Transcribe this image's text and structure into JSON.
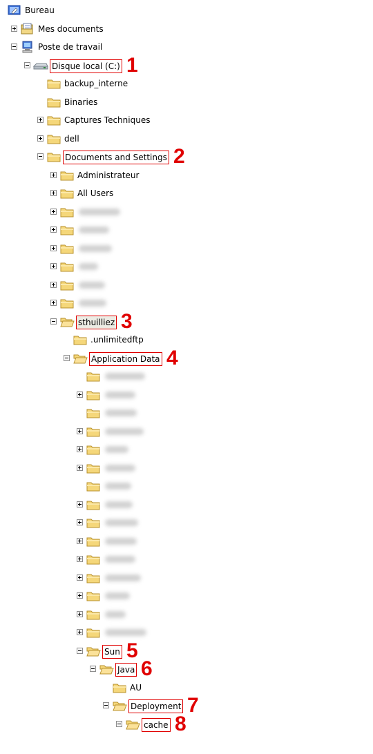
{
  "tree": {
    "rows": [
      {
        "label": "Bureau",
        "icon": "desktop-icon",
        "expander": "none",
        "level": 0
      },
      {
        "label": "Mes documents",
        "icon": "documents-icon",
        "expander": "plus",
        "level": 1
      },
      {
        "label": "Poste de travail",
        "icon": "computer-icon",
        "expander": "minus",
        "level": 1
      },
      {
        "label": "Disque local (C:)",
        "icon": "drive-icon",
        "expander": "minus",
        "level": 2,
        "boxed": true,
        "marker": "1"
      },
      {
        "label": "backup_interne",
        "icon": "folder-icon",
        "expander": "none",
        "level": 3
      },
      {
        "label": "Binaries",
        "icon": "folder-icon",
        "expander": "none",
        "level": 3
      },
      {
        "label": "Captures Techniques",
        "icon": "folder-icon",
        "expander": "plus",
        "level": 3
      },
      {
        "label": "dell",
        "icon": "folder-icon",
        "expander": "plus",
        "level": 3
      },
      {
        "label": "Documents and Settings",
        "icon": "folder-icon",
        "expander": "minus",
        "level": 3,
        "boxed": true,
        "marker": "2"
      },
      {
        "label": "Administrateur",
        "icon": "folder-icon",
        "expander": "plus",
        "level": 4
      },
      {
        "label": "All Users",
        "icon": "folder-icon",
        "expander": "plus",
        "level": 4
      },
      {
        "label": "",
        "icon": "folder-icon",
        "expander": "plus",
        "level": 4,
        "blurred": true
      },
      {
        "label": "",
        "icon": "folder-icon",
        "expander": "plus",
        "level": 4,
        "blurred": true
      },
      {
        "label": "",
        "icon": "folder-icon",
        "expander": "plus",
        "level": 4,
        "blurred": true
      },
      {
        "label": "",
        "icon": "folder-icon",
        "expander": "plus",
        "level": 4,
        "blurred": true
      },
      {
        "label": "",
        "icon": "folder-icon",
        "expander": "plus",
        "level": 4,
        "blurred": true
      },
      {
        "label": "",
        "icon": "folder-icon",
        "expander": "plus",
        "level": 4,
        "blurred": true
      },
      {
        "label": "sthuilliez",
        "icon": "folder-open-icon",
        "expander": "minus",
        "level": 4,
        "boxed": true,
        "selected": true,
        "marker": "3"
      },
      {
        "label": ".unlimitedftp",
        "icon": "folder-icon",
        "expander": "none",
        "level": 5
      },
      {
        "label": "Application Data",
        "icon": "folder-open-icon",
        "expander": "minus",
        "level": 5,
        "boxed": true,
        "marker": "4"
      },
      {
        "label": "",
        "icon": "folder-icon",
        "expander": "none",
        "level": 6,
        "blurred": true
      },
      {
        "label": "",
        "icon": "folder-icon",
        "expander": "plus",
        "level": 6,
        "blurred": true
      },
      {
        "label": "",
        "icon": "folder-icon",
        "expander": "none",
        "level": 6,
        "blurred": true
      },
      {
        "label": "",
        "icon": "folder-icon",
        "expander": "plus",
        "level": 6,
        "blurred": true
      },
      {
        "label": "",
        "icon": "folder-icon",
        "expander": "plus",
        "level": 6,
        "blurred": true
      },
      {
        "label": "",
        "icon": "folder-icon",
        "expander": "plus",
        "level": 6,
        "blurred": true
      },
      {
        "label": "",
        "icon": "folder-icon",
        "expander": "none",
        "level": 6,
        "blurred": true
      },
      {
        "label": "",
        "icon": "folder-icon",
        "expander": "plus",
        "level": 6,
        "blurred": true
      },
      {
        "label": "",
        "icon": "folder-icon",
        "expander": "plus",
        "level": 6,
        "blurred": true
      },
      {
        "label": "",
        "icon": "folder-icon",
        "expander": "plus",
        "level": 6,
        "blurred": true
      },
      {
        "label": "",
        "icon": "folder-icon",
        "expander": "plus",
        "level": 6,
        "blurred": true
      },
      {
        "label": "",
        "icon": "folder-icon",
        "expander": "plus",
        "level": 6,
        "blurred": true
      },
      {
        "label": "",
        "icon": "folder-icon",
        "expander": "plus",
        "level": 6,
        "blurred": true
      },
      {
        "label": "",
        "icon": "folder-icon",
        "expander": "plus",
        "level": 6,
        "blurred": true
      },
      {
        "label": "",
        "icon": "folder-icon",
        "expander": "plus",
        "level": 6,
        "blurred": true
      },
      {
        "label": "Sun",
        "icon": "folder-open-icon",
        "expander": "minus",
        "level": 6,
        "boxed": true,
        "marker": "5"
      },
      {
        "label": "Java",
        "icon": "folder-open-icon",
        "expander": "minus",
        "level": 7,
        "boxed": true,
        "marker": "6"
      },
      {
        "label": "AU",
        "icon": "folder-icon",
        "expander": "none",
        "level": 8
      },
      {
        "label": "Deployment",
        "icon": "folder-open-icon",
        "expander": "minus",
        "level": 8,
        "boxed": true,
        "marker": "7"
      },
      {
        "label": "cache",
        "icon": "folder-open-icon",
        "expander": "minus",
        "level": 9,
        "boxed": true,
        "marker": "8"
      }
    ]
  },
  "colors": {
    "annotation": "#e00000",
    "folder_fill": "#f5d77a",
    "folder_stroke": "#b8922e",
    "selection": "#ecece4"
  }
}
